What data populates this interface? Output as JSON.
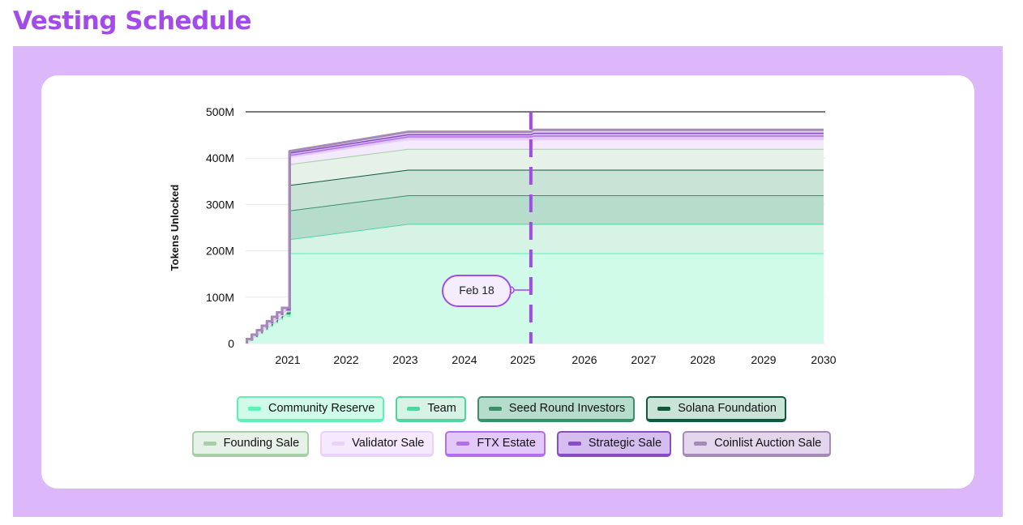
{
  "title": "Vesting Schedule",
  "colors": {
    "title": "#a24be8",
    "panel": "#dcb8fb",
    "marker": "#a24be8"
  },
  "marker": {
    "label": "Feb 18",
    "x": 2025.13
  },
  "chart_data": {
    "type": "area",
    "stacked": true,
    "title": "",
    "xlabel": "",
    "ylabel": "Tokens Unlocked",
    "xlim": [
      2020.3,
      2030
    ],
    "ylim": [
      0,
      500
    ],
    "y_unit": "M",
    "y_ticks": [
      0,
      100,
      200,
      300,
      400,
      500
    ],
    "y_tick_labels": [
      "0",
      "100M",
      "200M",
      "300M",
      "400M",
      "500M"
    ],
    "x_ticks": [
      2021,
      2022,
      2023,
      2024,
      2025,
      2026,
      2027,
      2028,
      2029,
      2030
    ],
    "x_tick_labels": [
      "2021",
      "2022",
      "2023",
      "2024",
      "2025",
      "2026",
      "2027",
      "2028",
      "2029",
      "2030"
    ],
    "grid": "horizontal",
    "legend_position": "bottom",
    "x": [
      2020.3,
      2020.99,
      2021.03,
      2023.05,
      2025.13,
      2025.18,
      2030
    ],
    "series": [
      {
        "name": "Community Reserve",
        "color": "#5ff0b8",
        "fill": "#cffbe8",
        "values": [
          0,
          60,
          195,
          195,
          195,
          195,
          195
        ]
      },
      {
        "name": "Team",
        "color": "#4fd6a0",
        "fill": "#d6f3e6",
        "values": [
          0,
          3,
          30,
          63,
          63,
          63,
          63
        ]
      },
      {
        "name": "Seed Round Investors",
        "color": "#3b8f6a",
        "fill": "#b6dccb",
        "values": [
          0,
          2,
          62,
          62,
          62,
          62,
          62
        ]
      },
      {
        "name": "Solana Foundation",
        "color": "#0f5a3c",
        "fill": "#c9e3d6",
        "values": [
          0,
          2,
          55,
          55,
          55,
          55,
          55
        ]
      },
      {
        "name": "Founding Sale",
        "color": "#a6cfa8",
        "fill": "#e6f1e8",
        "values": [
          0,
          2,
          45,
          45,
          45,
          45,
          45
        ]
      },
      {
        "name": "Validator Sale",
        "color": "#ead2fb",
        "fill": "#f5e9fd",
        "values": [
          0,
          2,
          15,
          20,
          20,
          20,
          20
        ]
      },
      {
        "name": "FTX Estate",
        "color": "#b36ef0",
        "fill": "#e3c9fa",
        "values": [
          0,
          2,
          5,
          7,
          7,
          9,
          9
        ]
      },
      {
        "name": "Strategic Sale",
        "color": "#8a4cc4",
        "fill": "#d6bdf0",
        "values": [
          0,
          2,
          5,
          5,
          5,
          6,
          6
        ]
      },
      {
        "name": "Coinlist Auction Sale",
        "color": "#a58ab8",
        "fill": "#e2d5ec",
        "values": [
          0,
          2,
          3,
          5,
          5,
          6,
          6
        ]
      }
    ]
  }
}
